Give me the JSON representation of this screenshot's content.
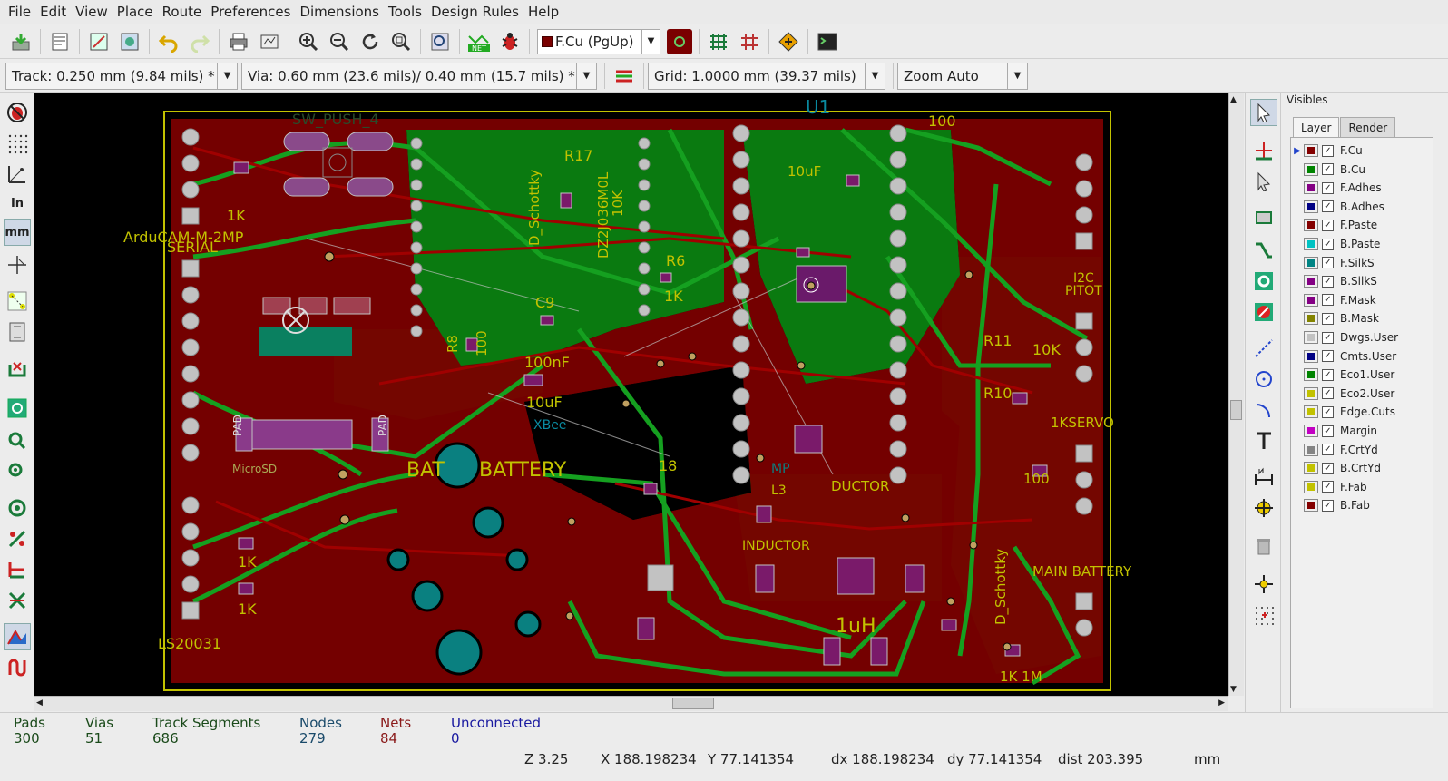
{
  "menu": [
    "File",
    "Edit",
    "View",
    "Place",
    "Route",
    "Preferences",
    "Dimensions",
    "Tools",
    "Design Rules",
    "Help"
  ],
  "toolbar": {
    "active_layer": "F.Cu (PgUp)",
    "net_label": "NET"
  },
  "options": {
    "track": "Track: 0.250 mm (9.84 mils) *",
    "via": "Via: 0.60 mm (23.6 mils)/ 0.40 mm (15.7 mils) *",
    "grid": "Grid: 1.0000 mm (39.37 mils)",
    "zoom": "Zoom Auto"
  },
  "left_tools": {
    "units_in": "In",
    "units_mm": "mm"
  },
  "visibles": {
    "title": "Visibles",
    "tabs": [
      "Layer",
      "Render"
    ],
    "layers": [
      {
        "name": "F.Cu",
        "color": "#840000",
        "checked": true,
        "active": true
      },
      {
        "name": "B.Cu",
        "color": "#008400",
        "checked": true
      },
      {
        "name": "F.Adhes",
        "color": "#840084",
        "checked": true
      },
      {
        "name": "B.Adhes",
        "color": "#000084",
        "checked": true
      },
      {
        "name": "F.Paste",
        "color": "#840000",
        "checked": true
      },
      {
        "name": "B.Paste",
        "color": "#00c2c2",
        "checked": true
      },
      {
        "name": "F.SilkS",
        "color": "#008484",
        "checked": true
      },
      {
        "name": "B.SilkS",
        "color": "#840084",
        "checked": true
      },
      {
        "name": "F.Mask",
        "color": "#840084",
        "checked": true
      },
      {
        "name": "B.Mask",
        "color": "#848400",
        "checked": true
      },
      {
        "name": "Dwgs.User",
        "color": "#c2c2c2",
        "checked": true
      },
      {
        "name": "Cmts.User",
        "color": "#000084",
        "checked": true
      },
      {
        "name": "Eco1.User",
        "color": "#008400",
        "checked": true
      },
      {
        "name": "Eco2.User",
        "color": "#c2c200",
        "checked": true
      },
      {
        "name": "Edge.Cuts",
        "color": "#c2c200",
        "checked": true
      },
      {
        "name": "Margin",
        "color": "#c200c2",
        "checked": true
      },
      {
        "name": "F.CrtYd",
        "color": "#848484",
        "checked": true
      },
      {
        "name": "B.CrtYd",
        "color": "#c2c200",
        "checked": true
      },
      {
        "name": "F.Fab",
        "color": "#c2c200",
        "checked": true
      },
      {
        "name": "B.Fab",
        "color": "#840000",
        "checked": true
      }
    ]
  },
  "pcb_labels": {
    "u1": "U1",
    "sw": "SW_PUSH_4",
    "arducam": "ArduCAM-M-2MP",
    "serial": "SERIAL",
    "bat": "BAT",
    "battery": "BATTERY",
    "xbee": "XBee",
    "microsd": "MicroSD",
    "ls": "LS20031",
    "inductor": "INDUCTOR",
    "main_battery": "MAIN BATTERY",
    "servo": "1KSERVO",
    "i2c": "I2C",
    "pitot": "PITOT",
    "c9": "C9",
    "r6": "R6",
    "r8": "R8",
    "r11": "R11",
    "r10": "R10",
    "r17": "R17",
    "r18": "18",
    "l3": "L3",
    "d_schottky": "D_Schottky",
    "dz": "DZ2J036M0L",
    "k1": "1K",
    "k10": "10K",
    "u10": "10uF",
    "u100": "100nF",
    "uh": "1uH",
    "v100": "100",
    "pad": "PAD",
    "mp": "MP",
    "ductor": "DUCTOR",
    "n100": "100",
    "k1m": "1K 1M",
    "u10b": "10uF"
  },
  "status": {
    "pads_label": "Pads",
    "pads": "300",
    "vias_label": "Vias",
    "vias": "51",
    "tracks_label": "Track Segments",
    "tracks": "686",
    "nodes_label": "Nodes",
    "nodes": "279",
    "nets_label": "Nets",
    "nets": "84",
    "unconnected_label": "Unconnected",
    "unconnected": "0",
    "zoom": "Z 3.25",
    "x": "X 188.198234",
    "y": "Y 77.141354",
    "dx": "dx 188.198234",
    "dy": "dy 77.141354",
    "dist": "dist 203.395",
    "units": "mm"
  }
}
